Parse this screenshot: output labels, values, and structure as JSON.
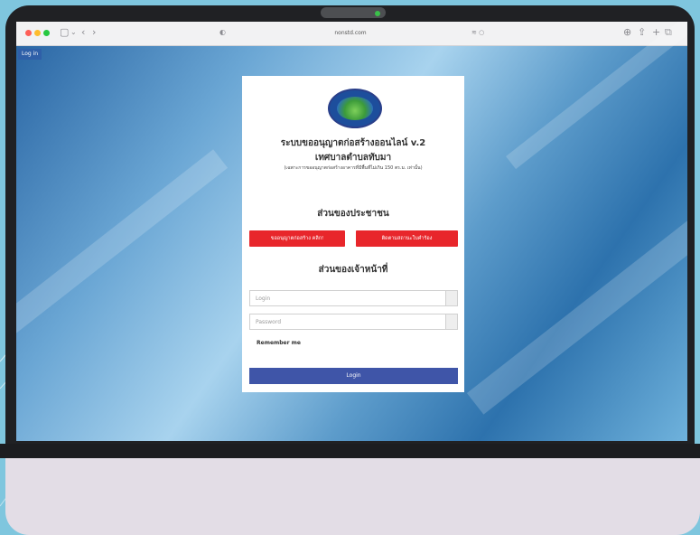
{
  "browser": {
    "url": "nonstd.com",
    "tab_indicator": "≋ ○"
  },
  "page": {
    "login_link": "Log in",
    "title_line1": "ระบบขออนุญาตก่อสร้างออนไลน์ v.2",
    "title_line2": "เทศบาลตำบลทับมา",
    "note": "(เฉพาะการขออนุญาตก่อสร้างอาคารที่มีพื้นที่ไม่เกิน 150 ตร.ม. เท่านั้น)",
    "public_section": "ส่วนของประชาชน",
    "btn_request": "ขออนุญาตก่อสร้าง คลิก!",
    "btn_check": "ติดตามสถานะใบคำร้อง",
    "staff_section": "ส่วนของเจ้าหน้าที่",
    "login_placeholder": "Login",
    "password_placeholder": "Password",
    "remember_me": "Remember me",
    "login_button": "Login"
  },
  "colors": {
    "red_button": "#e8262b",
    "blue_button": "#3f55a8",
    "background": "#7fc6de"
  }
}
